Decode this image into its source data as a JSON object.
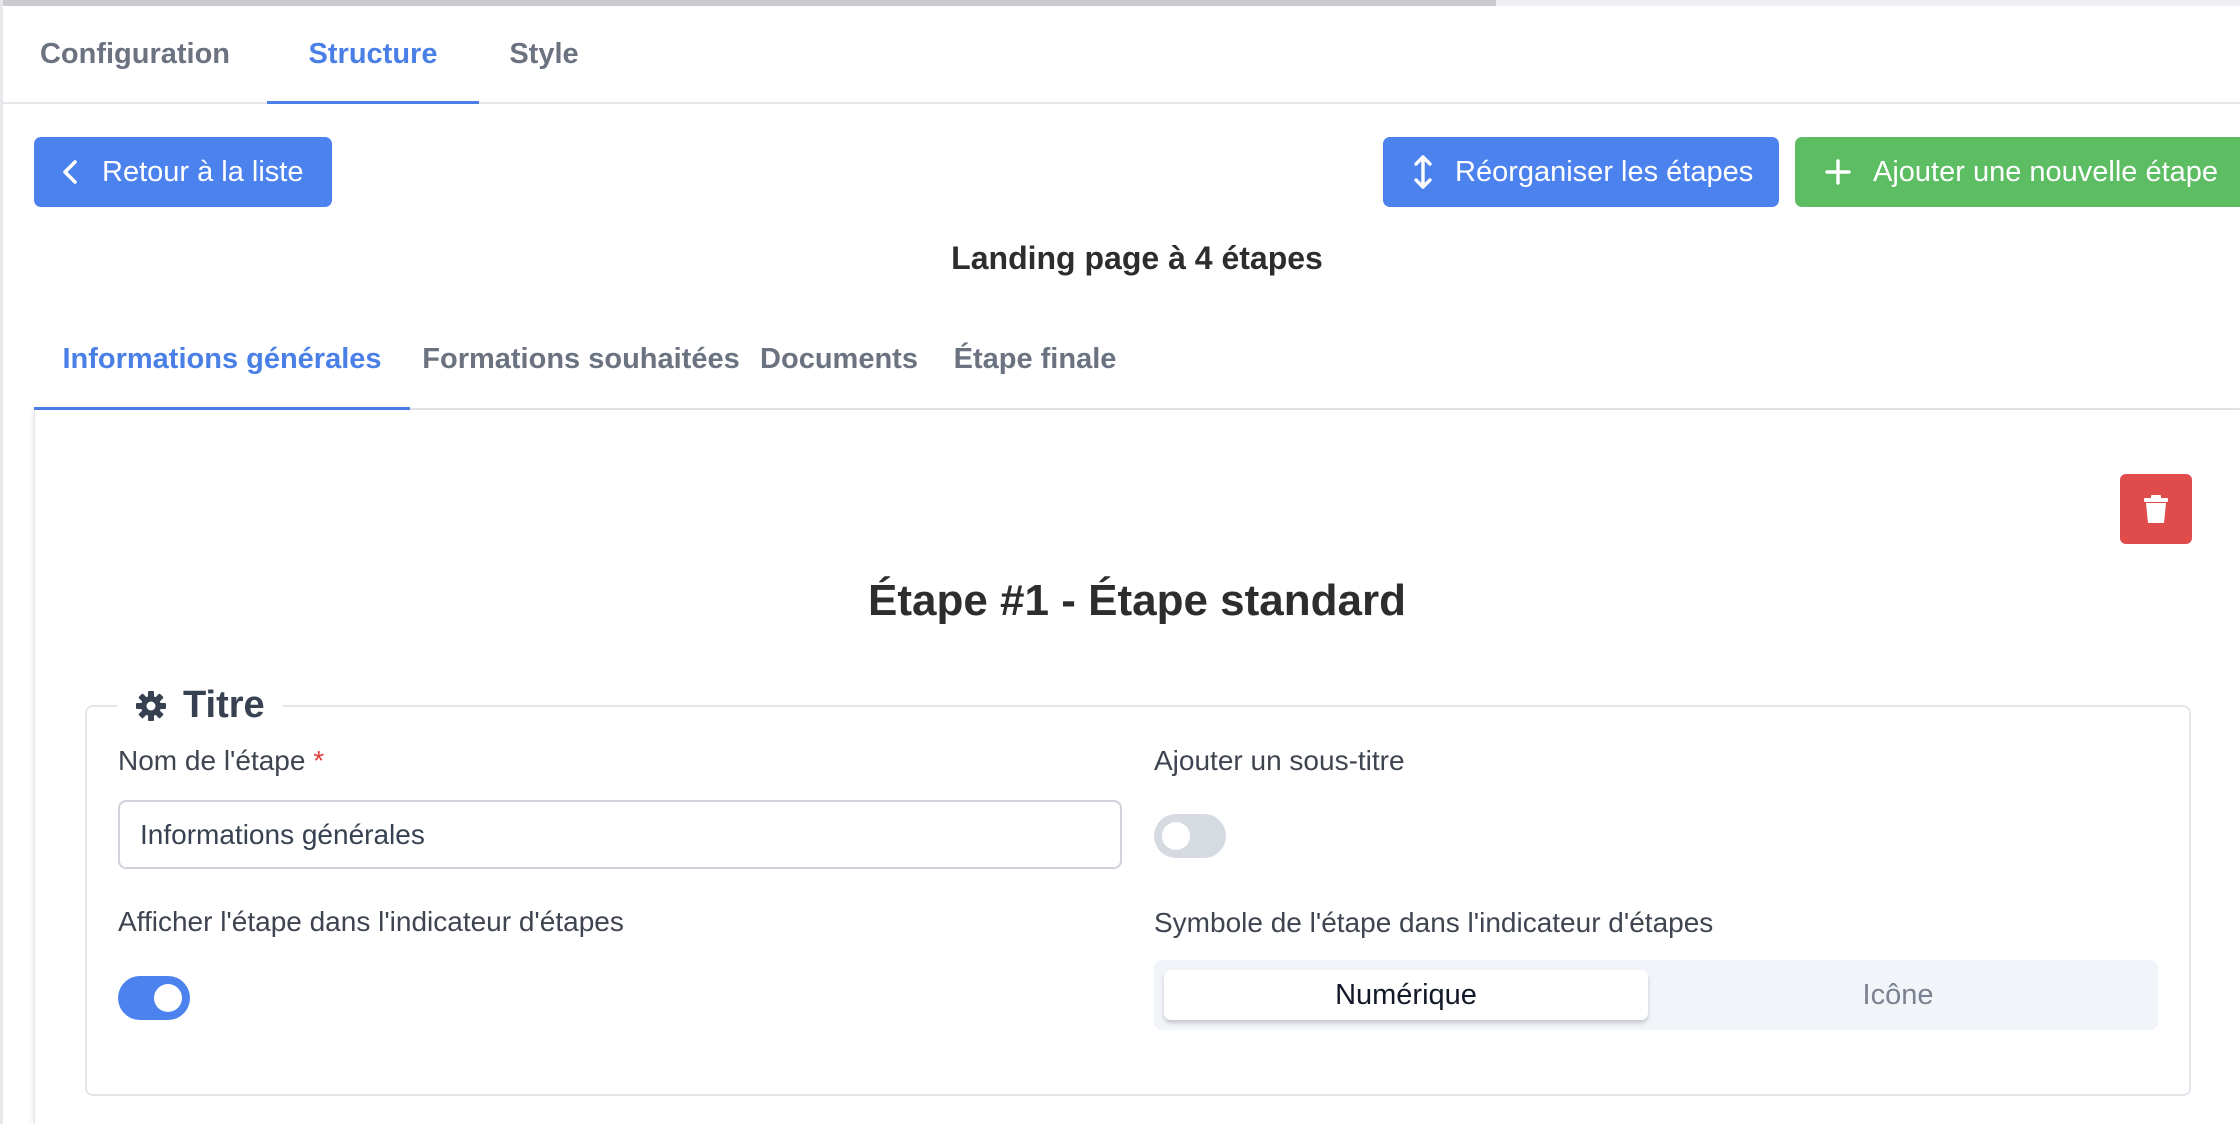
{
  "top_tabs": [
    {
      "label": "Configuration",
      "active": false
    },
    {
      "label": "Structure",
      "active": true
    },
    {
      "label": "Style",
      "active": false
    }
  ],
  "actions": {
    "back_label": "Retour à la liste",
    "reorder_label": "Réorganiser les étapes",
    "add_step_label": "Ajouter une nouvelle étape"
  },
  "page_heading": "Landing page à 4 étapes",
  "step_tabs": [
    {
      "label": "Informations générales",
      "active": true
    },
    {
      "label": "Formations souhaitées",
      "active": false
    },
    {
      "label": "Documents",
      "active": false
    },
    {
      "label": "Étape finale",
      "active": false
    }
  ],
  "step": {
    "title": "Étape #1 - Étape standard",
    "section_title": "Titre",
    "name_label": "Nom de l'étape",
    "required_marker": "*",
    "name_value": "Informations générales",
    "subtitle_label": "Ajouter un sous-titre",
    "subtitle_enabled": false,
    "indicator_label": "Afficher l'étape dans l'indicateur d'étapes",
    "indicator_enabled": true,
    "symbol_label": "Symbole de l'étape dans l'indicateur d'étapes",
    "symbol_options": [
      "Numérique",
      "Icône"
    ],
    "symbol_selected": "Numérique"
  },
  "icons": {
    "back": "chevron-left-icon",
    "reorder": "arrows-vertical-icon",
    "add": "plus-icon",
    "delete": "trash-icon",
    "section": "gear-icon"
  },
  "colors": {
    "accent": "#4c82ee",
    "success": "#5cbd63",
    "danger": "#e04b4b"
  }
}
